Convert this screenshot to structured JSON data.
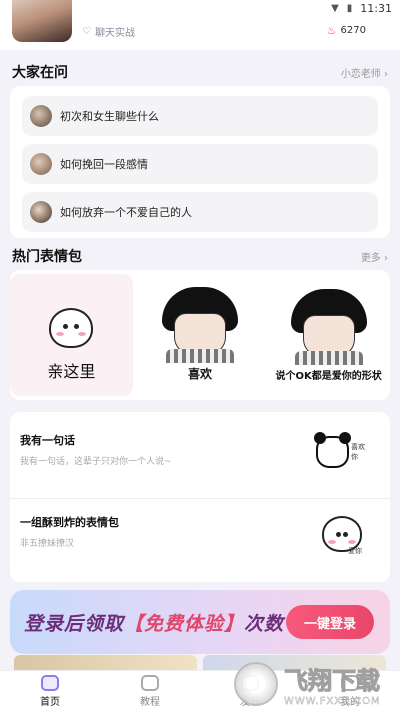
{
  "status": {
    "time": "11:31"
  },
  "top_card": {
    "tag": "聊天实战",
    "count": "6270"
  },
  "ask_section": {
    "title": "大家在问",
    "more": "小恋老师 ›",
    "items": [
      {
        "label": "初次和女生聊些什么"
      },
      {
        "label": "如何挽回一段感情"
      },
      {
        "label": "如何放弃一个不爱自己的人"
      }
    ]
  },
  "sticker_section": {
    "title": "热门表情包",
    "more": "更多 ›",
    "items": [
      {
        "caption": "亲这里"
      },
      {
        "caption": "喜欢"
      },
      {
        "caption": "说个OK都是爱你的形状"
      }
    ]
  },
  "quote_section": {
    "items": [
      {
        "title": "我有一句话",
        "subtitle": "我有一句话，这辈子只对你一个人说~",
        "sticker_text": "喜欢你"
      },
      {
        "title": "一组酥到炸的表情包",
        "subtitle": "非五撩妹撩汉",
        "sticker_text": "爱你"
      }
    ]
  },
  "banner": {
    "text_prefix": "登录后领取",
    "text_highlight": "【免费体验】",
    "text_suffix": "次数",
    "button": "一键登录"
  },
  "tabbar": {
    "tabs": [
      {
        "label": "首页"
      },
      {
        "label": "教程"
      },
      {
        "label": "发现"
      },
      {
        "label": "我的"
      }
    ]
  },
  "watermark": {
    "brand": "飞翔下载",
    "url": "WWW.FXXZ.COM"
  },
  "colors": {
    "accent": "#e8466a",
    "background": "#f3f2f8"
  }
}
